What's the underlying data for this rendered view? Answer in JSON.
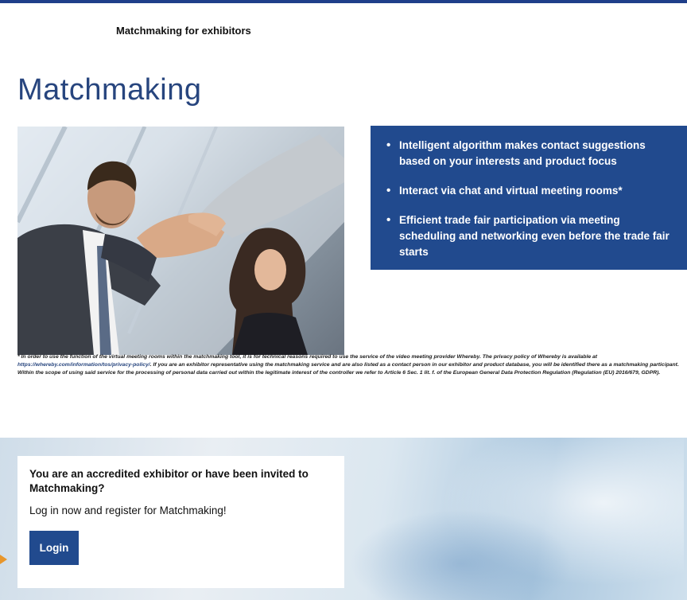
{
  "header": {
    "breadcrumb": "Matchmaking for exhibitors"
  },
  "page": {
    "title": "Matchmaking"
  },
  "hero": {
    "image": "handshake-photo"
  },
  "features": [
    "Intelligent algorithm makes contact suggestions based on your interests and product focus",
    "Interact via chat and virtual meeting rooms*",
    "Efficient trade fair participation via meeting scheduling and networking even before the trade fair starts"
  ],
  "footnote": {
    "text_before": "* In order to use the function of the virtual meeting rooms within the matchmaking tool, it is for technical reasons required to use the service of the video meeting provider Whereby. The privacy policy of Whereby is available at ",
    "link": "https://whereby.com/information/tos/privacy-policy/",
    "text_after": ". If you are an exhibitor representative using the matchmaking service and are also listed as a contact person in our exhibitor and product database, you will be identified there as a matchmaking participant. Within the scope of using said service for the processing of personal data carried out within the legitimate interest of the controller we refer to Article 6 Sec. 1 lit. f. of the European General Data Protection Regulation (Regulation (EU) 2016/679, GDPR)."
  },
  "login": {
    "heading": "You are an accredited exhibitor or have been invited to Matchmaking?",
    "text": "Log in now and register for Matchmaking!",
    "button_label": "Login"
  },
  "colors": {
    "brand_blue": "#214a8e",
    "title_blue": "#27457e",
    "pointer_orange": "#e8962b"
  }
}
